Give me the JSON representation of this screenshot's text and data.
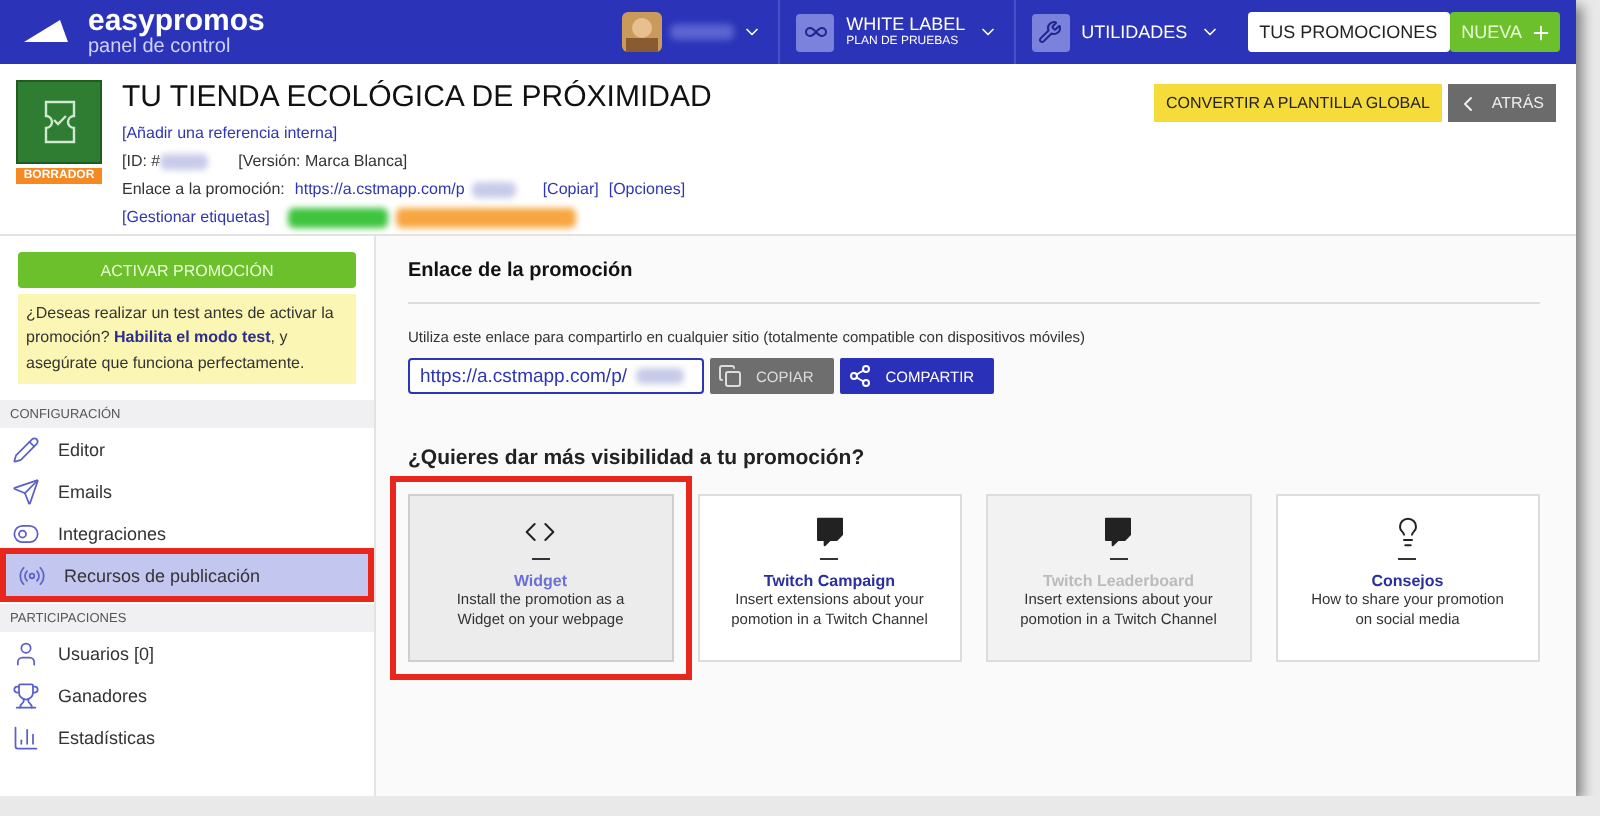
{
  "topbar": {
    "brand": "easypromos",
    "subtitle": "panel de control",
    "plan": {
      "title": "WHITE LABEL",
      "subtitle": "PLAN DE PRUEBAS"
    },
    "utilities": "UTILIDADES",
    "promotions_button": "TUS PROMOCIONES",
    "new_button": "NUEVA"
  },
  "header": {
    "status": "BORRADOR",
    "title": "TU TIENDA ECOLÓGICA DE PRÓXIMIDAD",
    "reference_link": "[Añadir una referencia interna]",
    "id_label": "[ID: #",
    "version": "[Versión: Marca Blanca]",
    "link_label": "Enlace a la promoción:",
    "link_url": "https://a.cstmapp.com/p",
    "copy_link": "[Copiar]",
    "options_link": "[Opciones]",
    "tags_link": "[Gestionar etiquetas]",
    "convert_button": "CONVERTIR A PLANTILLA GLOBAL",
    "back_button": "ATRÁS"
  },
  "sidebar": {
    "activate_button": "ACTIVAR PROMOCIÓN",
    "notice": "¿Deseas realizar un test antes de activar la promoción? **Habilita el modo test**, y asegúrate que funciona perfectamente.",
    "sections": [
      {
        "title": "CONFIGURACIÓN",
        "items": [
          {
            "label": "Editor",
            "selected": false,
            "highlighted": false
          },
          {
            "label": "Emails",
            "selected": false,
            "highlighted": false
          },
          {
            "label": "Integraciones",
            "selected": false,
            "highlighted": false
          },
          {
            "label": "Recursos de publicación",
            "selected": true,
            "highlighted": true
          }
        ]
      },
      {
        "title": "PARTICIPACIONES",
        "items": [
          {
            "label": "Usuarios [0]",
            "selected": false,
            "highlighted": false
          },
          {
            "label": "Ganadores",
            "selected": false,
            "highlighted": false
          },
          {
            "label": "Estadísticas",
            "selected": false,
            "highlighted": false
          }
        ]
      }
    ]
  },
  "link_section": {
    "title": "Enlace de la promoción",
    "description": "Utiliza este enlace para compartirlo en cualquier sitio (totalmente compatible con dispositivos móviles)",
    "url": "https://a.cstmapp.com/p/",
    "copy_button": "COPIAR",
    "share_button": "COMPARTIR"
  },
  "visibility": {
    "title": "¿Quieres dar más visibilidad a tu promoción?",
    "cards": [
      {
        "title": "Widget",
        "description": "Install the promotion as a Widget on your webpage",
        "selected": true,
        "disabled": false,
        "highlighted": true
      },
      {
        "title": "Twitch Campaign",
        "description": "Insert extensions about your pomotion in a Twitch Channel",
        "selected": false,
        "disabled": false,
        "highlighted": false
      },
      {
        "title": "Twitch Leaderboard",
        "description": "Insert extensions about your pomotion in a Twitch Channel",
        "selected": false,
        "disabled": true,
        "highlighted": false
      },
      {
        "title": "Consejos",
        "description": "How to share your promotion on social media",
        "selected": false,
        "disabled": false,
        "highlighted": false
      }
    ]
  }
}
